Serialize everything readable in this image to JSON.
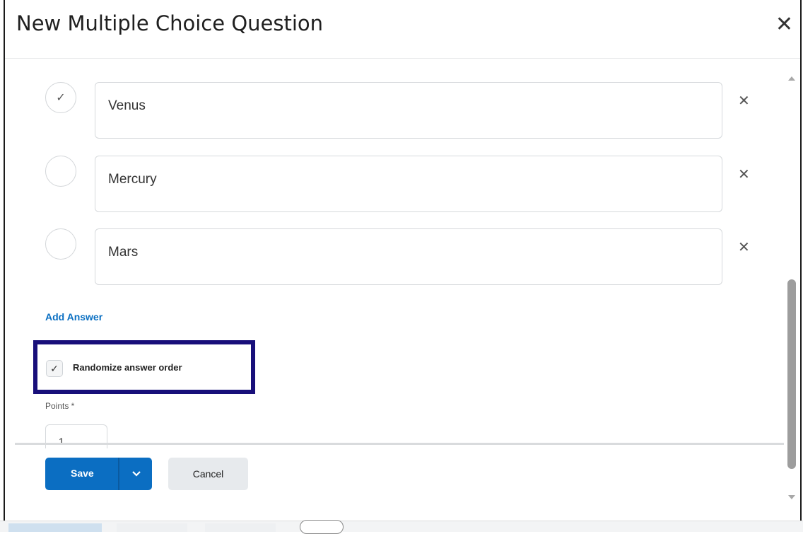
{
  "dialog": {
    "title": "New Multiple Choice Question",
    "close_icon": "close-icon"
  },
  "answers": [
    {
      "text": "Venus",
      "correct": true
    },
    {
      "text": "Mercury",
      "correct": false
    },
    {
      "text": "Mars",
      "correct": false
    }
  ],
  "add_answer_label": "Add Answer",
  "randomize": {
    "label": "Randomize answer order",
    "checked": true
  },
  "points": {
    "label": "Points *",
    "value": "1"
  },
  "footer": {
    "save_label": "Save",
    "cancel_label": "Cancel"
  },
  "colors": {
    "primary": "#0b6ec2",
    "highlight_border": "#180f7a",
    "link": "#0a6fc2"
  }
}
